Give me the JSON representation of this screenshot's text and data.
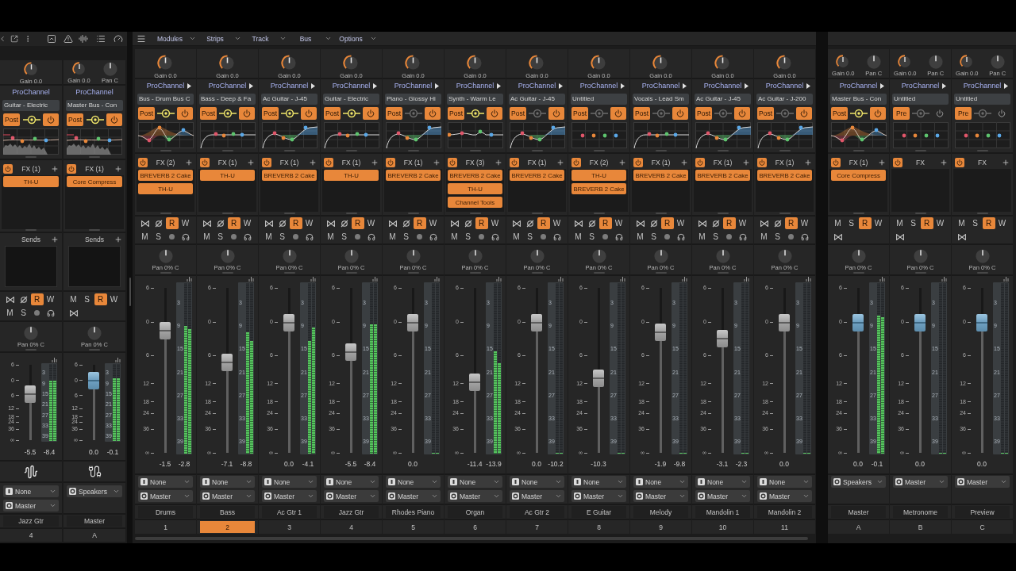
{
  "inspector": {
    "strips": [
      {
        "kind": "track",
        "knobs": [
          {
            "kind": "gain",
            "label": "Gain 0.0"
          }
        ],
        "prochannel": {
          "label": "ProChannel",
          "preset": "Guitar - Electric",
          "mode": "Post",
          "link": true,
          "power": true,
          "eq": {
            "kind": "analyzer"
          }
        },
        "fx": {
          "power": true,
          "label": "FX (1)",
          "plugins": [
            "TH-U"
          ]
        },
        "sends": {
          "label": "Sends"
        },
        "buttons": [
          [
            {
              "kind": "bypass",
              "on": false
            },
            {
              "kind": "phase",
              "on": false
            },
            {
              "kind": "text",
              "label": "R",
              "on": true
            },
            {
              "kind": "text",
              "label": "W",
              "on": false
            }
          ],
          [
            {
              "kind": "text",
              "label": "M",
              "on": false
            },
            {
              "kind": "text",
              "label": "S",
              "on": false
            },
            {
              "kind": "arm",
              "on": false
            },
            {
              "kind": "echo",
              "on": false
            }
          ]
        ],
        "pan": "Pan 0% C",
        "fader": {
          "scale": [
            "6",
            "0",
            "6",
            "12",
            "18",
            "24",
            "36",
            "∞"
          ],
          "meter_scale": [
            "3",
            "9",
            "15",
            "21",
            "27",
            "33",
            "39"
          ],
          "level": 0.61,
          "reading": "-5.5",
          "meters": [
            {
              "level": 0.78
            },
            {
              "level": 0.78
            }
          ],
          "peak": "-8.4"
        },
        "io": [
          {
            "kind": "input",
            "label": "None"
          },
          {
            "kind": "output",
            "label": "Master"
          }
        ],
        "name": "Jazz Gtr",
        "number": "4",
        "selected": false
      },
      {
        "kind": "bus",
        "knobs": [
          {
            "kind": "gain",
            "label": "Gain 0.0"
          },
          {
            "kind": "pan",
            "label": "Pan C"
          }
        ],
        "prochannel": {
          "label": "ProChannel",
          "preset": "Master Bus - Con",
          "mode": "Post",
          "link": true,
          "power": true,
          "eq": {
            "kind": "analyzer"
          }
        },
        "fx": {
          "power": true,
          "label": "FX (1)",
          "plugins": [
            "Core Compress"
          ]
        },
        "sends": {
          "label": "Sends"
        },
        "buttons": [
          [
            {
              "kind": "text",
              "label": "M",
              "on": false
            },
            {
              "kind": "text",
              "label": "S",
              "on": false
            },
            {
              "kind": "text",
              "label": "R",
              "on": true
            },
            {
              "kind": "text",
              "label": "W",
              "on": false
            }
          ],
          [
            {
              "kind": "bypass",
              "on": false
            }
          ]
        ],
        "pan": "Pan 0% C",
        "fader": {
          "scale": [
            "6",
            "0",
            "6",
            "12",
            "18",
            "24",
            "36",
            "∞"
          ],
          "meter_scale": [
            "3",
            "9",
            "15",
            "21",
            "27",
            "33",
            "39"
          ],
          "level": 0.79,
          "reading": "0.0",
          "meters": [
            {
              "level": 0.81
            },
            {
              "level": 0.81
            }
          ],
          "peak": "-0.1"
        },
        "io": [
          {
            "kind": "output",
            "label": "Speakers"
          }
        ],
        "name": "Master",
        "number": "A",
        "selected": false
      }
    ]
  },
  "console": {
    "menus": [
      {
        "label": "Modules"
      },
      {
        "label": "Strips"
      },
      {
        "label": "Track"
      },
      {
        "label": "Bus"
      },
      {
        "label": "Options"
      }
    ],
    "strips": [
      {
        "kind": "track",
        "knobs": [
          {
            "kind": "gain",
            "label": "Gain 0.0"
          }
        ],
        "prochannel": {
          "label": "ProChannel",
          "arrow": true,
          "preset": "Bus - Drum Bus C",
          "mode": "Post",
          "link": true,
          "power": true,
          "eq": {
            "kind": "peaks"
          }
        },
        "fx": {
          "power": true,
          "label": "FX (2)",
          "plugins": [
            "BREVERB 2 Cake",
            "TH-U"
          ]
        },
        "buttons": [
          [
            {
              "kind": "bypass",
              "on": false
            },
            {
              "kind": "phase",
              "on": false
            },
            {
              "kind": "text",
              "label": "R",
              "on": true
            },
            {
              "kind": "text",
              "label": "W",
              "on": false
            }
          ],
          [
            {
              "kind": "text",
              "label": "M",
              "on": false
            },
            {
              "kind": "text",
              "label": "S",
              "on": false
            },
            {
              "kind": "arm",
              "on": false
            },
            {
              "kind": "echo",
              "on": false
            }
          ]
        ],
        "pan": "Pan 0% C",
        "fader": {
          "scale": [
            "6",
            "0",
            "6",
            "12",
            "18",
            "24",
            "36",
            "∞"
          ],
          "meter_scale": [
            "3",
            "9",
            "15",
            "21",
            "27",
            "33",
            "39"
          ],
          "level": 0.74,
          "reading": "-1.5",
          "meters": [
            {
              "level": 0.75
            },
            {
              "level": 0.73
            }
          ],
          "peak": "-2.8"
        },
        "io": [
          {
            "kind": "input",
            "label": "None"
          },
          {
            "kind": "output",
            "label": "Master"
          }
        ],
        "name": "Drums",
        "number": "1",
        "selected": false
      },
      {
        "kind": "track",
        "knobs": [
          {
            "kind": "gain",
            "label": "Gain 0.0"
          }
        ],
        "prochannel": {
          "label": "ProChannel",
          "arrow": true,
          "preset": "Bass - Deep & Fa",
          "mode": "Post",
          "link": true,
          "power": true,
          "eq": {
            "kind": "lowcut"
          }
        },
        "fx": {
          "power": true,
          "label": "FX (1)",
          "plugins": [
            "TH-U"
          ]
        },
        "buttons": [
          [
            {
              "kind": "bypass",
              "on": false
            },
            {
              "kind": "phase",
              "on": false
            },
            {
              "kind": "text",
              "label": "R",
              "on": true
            },
            {
              "kind": "text",
              "label": "W",
              "on": false
            }
          ],
          [
            {
              "kind": "text",
              "label": "M",
              "on": false
            },
            {
              "kind": "text",
              "label": "S",
              "on": false
            },
            {
              "kind": "arm",
              "on": false
            },
            {
              "kind": "echo",
              "on": false
            }
          ]
        ],
        "pan": "Pan 0% C",
        "fader": {
          "scale": [
            "6",
            "0",
            "6",
            "12",
            "18",
            "24",
            "36",
            "∞"
          ],
          "meter_scale": [
            "3",
            "9",
            "15",
            "21",
            "27",
            "33",
            "39"
          ],
          "level": 0.55,
          "reading": "-7.1",
          "meters": [
            {
              "level": 0.71
            },
            {
              "level": 0.66
            }
          ],
          "peak": "-8.8"
        },
        "io": [
          {
            "kind": "input",
            "label": "None"
          },
          {
            "kind": "output",
            "label": "Master"
          }
        ],
        "name": "Bass",
        "number": "2",
        "selected": true
      },
      {
        "kind": "track",
        "knobs": [
          {
            "kind": "gain",
            "label": "Gain 0.0"
          }
        ],
        "prochannel": {
          "label": "ProChannel",
          "arrow": true,
          "preset": "Ac Guitar - J-45",
          "mode": "Post",
          "link": true,
          "power": true,
          "eq": {
            "kind": "shelf"
          }
        },
        "fx": {
          "power": true,
          "label": "FX (1)",
          "plugins": [
            "BREVERB 2 Cake"
          ]
        },
        "buttons": [
          [
            {
              "kind": "bypass",
              "on": false
            },
            {
              "kind": "phase",
              "on": false
            },
            {
              "kind": "text",
              "label": "R",
              "on": true
            },
            {
              "kind": "text",
              "label": "W",
              "on": false
            }
          ],
          [
            {
              "kind": "text",
              "label": "M",
              "on": false
            },
            {
              "kind": "text",
              "label": "S",
              "on": false
            },
            {
              "kind": "arm",
              "on": false
            },
            {
              "kind": "echo",
              "on": false
            }
          ]
        ],
        "pan": "Pan 0% C",
        "fader": {
          "scale": [
            "6",
            "0",
            "6",
            "12",
            "18",
            "24",
            "36",
            "∞"
          ],
          "meter_scale": [
            "3",
            "9",
            "15",
            "21",
            "27",
            "33",
            "39"
          ],
          "level": 0.79,
          "reading": "0.0",
          "meters": [
            {
              "level": 0.66
            },
            {
              "level": 0.74
            }
          ],
          "peak": "-4.1"
        },
        "io": [
          {
            "kind": "input",
            "label": "None"
          },
          {
            "kind": "output",
            "label": "Master"
          }
        ],
        "name": "Ac Gtr 1",
        "number": "3",
        "selected": false
      },
      {
        "kind": "track",
        "knobs": [
          {
            "kind": "gain",
            "label": "Gain 0.0"
          }
        ],
        "prochannel": {
          "label": "ProChannel",
          "arrow": true,
          "preset": "Guitar - Electric",
          "mode": "Post",
          "link": true,
          "power": true,
          "eq": {
            "kind": "lowcut"
          }
        },
        "fx": {
          "power": true,
          "label": "FX (1)",
          "plugins": [
            "TH-U"
          ]
        },
        "buttons": [
          [
            {
              "kind": "bypass",
              "on": false
            },
            {
              "kind": "phase",
              "on": false
            },
            {
              "kind": "text",
              "label": "R",
              "on": true
            },
            {
              "kind": "text",
              "label": "W",
              "on": false
            }
          ],
          [
            {
              "kind": "text",
              "label": "M",
              "on": false
            },
            {
              "kind": "text",
              "label": "S",
              "on": false
            },
            {
              "kind": "arm",
              "on": false
            },
            {
              "kind": "echo",
              "on": false
            }
          ]
        ],
        "pan": "Pan 0% C",
        "fader": {
          "scale": [
            "6",
            "0",
            "6",
            "12",
            "18",
            "24",
            "36",
            "∞"
          ],
          "meter_scale": [
            "3",
            "9",
            "15",
            "21",
            "27",
            "33",
            "39"
          ],
          "level": 0.61,
          "reading": "-5.5",
          "meters": [
            {
              "level": 0.76
            },
            {
              "level": 0.76
            }
          ],
          "peak": "-8.4"
        },
        "io": [
          {
            "kind": "input",
            "label": "None"
          },
          {
            "kind": "output",
            "label": "Master"
          }
        ],
        "name": "Jazz Gtr",
        "number": "4",
        "selected": false
      },
      {
        "kind": "track",
        "knobs": [
          {
            "kind": "gain",
            "label": "Gain 0.0"
          }
        ],
        "prochannel": {
          "label": "ProChannel",
          "arrow": true,
          "preset": "Piano - Glossy Hi",
          "mode": "Post",
          "link": false,
          "power": true,
          "eq": {
            "kind": "shelf"
          }
        },
        "fx": {
          "power": true,
          "label": "FX (1)",
          "plugins": [
            "BREVERB 2 Cake"
          ]
        },
        "buttons": [
          [
            {
              "kind": "bypass",
              "on": false
            },
            {
              "kind": "phase",
              "on": false
            },
            {
              "kind": "text",
              "label": "R",
              "on": true
            },
            {
              "kind": "text",
              "label": "W",
              "on": false
            }
          ],
          [
            {
              "kind": "text",
              "label": "M",
              "on": false
            },
            {
              "kind": "text",
              "label": "S",
              "on": false
            },
            {
              "kind": "arm",
              "on": false
            },
            {
              "kind": "echo",
              "on": false
            }
          ]
        ],
        "pan": "Pan 0% C",
        "fader": {
          "scale": [
            "6",
            "0",
            "6",
            "12",
            "18",
            "24",
            "36",
            "∞"
          ],
          "meter_scale": [
            "3",
            "9",
            "15",
            "21",
            "27",
            "33",
            "39"
          ],
          "level": 0.79,
          "reading": "0.0",
          "meters": [
            {
              "level": 0
            },
            {
              "level": 0
            }
          ]
        },
        "io": [
          {
            "kind": "input",
            "label": "None"
          },
          {
            "kind": "output",
            "label": "Master"
          }
        ],
        "name": "Rhodes Piano",
        "number": "5",
        "selected": false
      },
      {
        "kind": "track",
        "knobs": [
          {
            "kind": "gain",
            "label": "Gain 0.0"
          }
        ],
        "prochannel": {
          "label": "ProChannel",
          "arrow": true,
          "preset": "Synth - Warm Le",
          "mode": "Post",
          "link": true,
          "power": true,
          "eq": {
            "kind": "line"
          }
        },
        "fx": {
          "power": true,
          "label": "FX (3)",
          "plugins": [
            "BREVERB 2 Cake",
            "TH-U",
            "Channel Tools"
          ]
        },
        "buttons": [
          [
            {
              "kind": "bypass",
              "on": false
            },
            {
              "kind": "phase",
              "on": false
            },
            {
              "kind": "text",
              "label": "R",
              "on": true
            },
            {
              "kind": "text",
              "label": "W",
              "on": false
            }
          ],
          [
            {
              "kind": "text",
              "label": "M",
              "on": false
            },
            {
              "kind": "text",
              "label": "S",
              "on": false
            },
            {
              "kind": "arm",
              "on": false
            },
            {
              "kind": "echo",
              "on": false
            }
          ]
        ],
        "pan": "Pan 0% C",
        "fader": {
          "scale": [
            "6",
            "0",
            "6",
            "12",
            "18",
            "24",
            "36",
            "∞"
          ],
          "meter_scale": [
            "3",
            "9",
            "15",
            "21",
            "27",
            "33",
            "39"
          ],
          "level": 0.43,
          "reading": "-11.4",
          "meters": [
            {
              "level": 0.6
            },
            {
              "level": 0.53
            }
          ],
          "peak": "-13.9"
        },
        "io": [
          {
            "kind": "input",
            "label": "None"
          },
          {
            "kind": "output",
            "label": "Master"
          }
        ],
        "name": "Organ",
        "number": "6",
        "selected": false
      },
      {
        "kind": "track",
        "knobs": [
          {
            "kind": "gain",
            "label": "Gain 0.0"
          }
        ],
        "prochannel": {
          "label": "ProChannel",
          "arrow": true,
          "preset": "Ac Guitar - J-45",
          "mode": "Post",
          "link": false,
          "power": true,
          "eq": {
            "kind": "shelf"
          }
        },
        "fx": {
          "power": true,
          "label": "FX (1)",
          "plugins": [
            "BREVERB 2 Cake"
          ]
        },
        "buttons": [
          [
            {
              "kind": "bypass",
              "on": false
            },
            {
              "kind": "phase",
              "on": false
            },
            {
              "kind": "text",
              "label": "R",
              "on": true
            },
            {
              "kind": "text",
              "label": "W",
              "on": false
            }
          ],
          [
            {
              "kind": "text",
              "label": "M",
              "on": false
            },
            {
              "kind": "text",
              "label": "S",
              "on": false
            },
            {
              "kind": "arm",
              "on": false
            },
            {
              "kind": "echo",
              "on": false
            }
          ]
        ],
        "pan": "Pan 0% C",
        "fader": {
          "scale": [
            "6",
            "0",
            "6",
            "12",
            "18",
            "24",
            "36",
            "∞"
          ],
          "meter_scale": [
            "3",
            "9",
            "15",
            "21",
            "27",
            "33",
            "39"
          ],
          "level": 0.79,
          "reading": "0.0",
          "meters": [
            {
              "level": 0
            },
            {
              "level": 0
            }
          ],
          "peak": "-10.2"
        },
        "io": [
          {
            "kind": "input",
            "label": "None"
          },
          {
            "kind": "output",
            "label": "Master"
          }
        ],
        "name": "Ac Gtr 2",
        "number": "7",
        "selected": false
      },
      {
        "kind": "track",
        "knobs": [
          {
            "kind": "gain",
            "label": "Gain 0.0"
          }
        ],
        "prochannel": {
          "label": "ProChannel",
          "arrow": true,
          "preset": "Untitled",
          "mode": "Post",
          "link": false,
          "power": true,
          "eq": {
            "kind": "flat"
          }
        },
        "fx": {
          "power": true,
          "label": "FX (2)",
          "plugins": [
            "TH-U",
            "BREVERB 2 Cake"
          ]
        },
        "buttons": [
          [
            {
              "kind": "bypass",
              "on": false
            },
            {
              "kind": "phase",
              "on": false
            },
            {
              "kind": "text",
              "label": "R",
              "on": true
            },
            {
              "kind": "text",
              "label": "W",
              "on": false
            }
          ],
          [
            {
              "kind": "text",
              "label": "M",
              "on": false
            },
            {
              "kind": "text",
              "label": "S",
              "on": false
            },
            {
              "kind": "arm",
              "on": false
            },
            {
              "kind": "echo",
              "on": false
            }
          ]
        ],
        "pan": "Pan 0% C",
        "fader": {
          "scale": [
            "6",
            "0",
            "6",
            "12",
            "18",
            "24",
            "36",
            "∞"
          ],
          "meter_scale": [
            "3",
            "9",
            "15",
            "21",
            "27",
            "33",
            "39"
          ],
          "level": 0.45,
          "reading": "-10.3",
          "meters": [
            {
              "level": 0
            },
            {
              "level": 0
            }
          ]
        },
        "io": [
          {
            "kind": "input",
            "label": "None"
          },
          {
            "kind": "output",
            "label": "Master"
          }
        ],
        "name": "E Guitar",
        "number": "8",
        "selected": false
      },
      {
        "kind": "track",
        "knobs": [
          {
            "kind": "gain",
            "label": "Gain 0.0"
          }
        ],
        "prochannel": {
          "label": "ProChannel",
          "arrow": true,
          "preset": "Vocals - Lead Sm",
          "mode": "Post",
          "link": false,
          "power": true,
          "eq": {
            "kind": "lowcut"
          }
        },
        "fx": {
          "power": true,
          "label": "FX (1)",
          "plugins": [
            "BREVERB 2 Cake"
          ]
        },
        "buttons": [
          [
            {
              "kind": "bypass",
              "on": false
            },
            {
              "kind": "phase",
              "on": false
            },
            {
              "kind": "text",
              "label": "R",
              "on": true
            },
            {
              "kind": "text",
              "label": "W",
              "on": false
            }
          ],
          [
            {
              "kind": "text",
              "label": "M",
              "on": false
            },
            {
              "kind": "text",
              "label": "S",
              "on": false
            },
            {
              "kind": "arm",
              "on": false
            },
            {
              "kind": "echo",
              "on": false
            }
          ]
        ],
        "pan": "Pan 0% C",
        "fader": {
          "scale": [
            "6",
            "0",
            "6",
            "12",
            "18",
            "24",
            "36",
            "∞"
          ],
          "meter_scale": [
            "3",
            "9",
            "15",
            "21",
            "27",
            "33",
            "39"
          ],
          "level": 0.73,
          "reading": "-1.9",
          "meters": [
            {
              "level": 0
            },
            {
              "level": 0
            }
          ],
          "peak": "-9.8"
        },
        "io": [
          {
            "kind": "input",
            "label": "None"
          },
          {
            "kind": "output",
            "label": "Master"
          }
        ],
        "name": "Melody",
        "number": "9",
        "selected": false
      },
      {
        "kind": "track",
        "knobs": [
          {
            "kind": "gain",
            "label": "Gain 0.0"
          }
        ],
        "prochannel": {
          "label": "ProChannel",
          "arrow": true,
          "preset": "Ac Guitar - J-45",
          "mode": "Post",
          "link": false,
          "power": true,
          "eq": {
            "kind": "shelf"
          }
        },
        "fx": {
          "power": true,
          "label": "FX (1)",
          "plugins": [
            "BREVERB 2 Cake"
          ]
        },
        "buttons": [
          [
            {
              "kind": "bypass",
              "on": false
            },
            {
              "kind": "phase",
              "on": false
            },
            {
              "kind": "text",
              "label": "R",
              "on": true
            },
            {
              "kind": "text",
              "label": "W",
              "on": false
            }
          ],
          [
            {
              "kind": "text",
              "label": "M",
              "on": false
            },
            {
              "kind": "text",
              "label": "S",
              "on": false
            },
            {
              "kind": "arm",
              "on": false
            },
            {
              "kind": "echo",
              "on": false
            }
          ]
        ],
        "pan": "Pan 0% C",
        "fader": {
          "scale": [
            "6",
            "0",
            "6",
            "12",
            "18",
            "24",
            "36",
            "∞"
          ],
          "meter_scale": [
            "3",
            "9",
            "15",
            "21",
            "27",
            "33",
            "39"
          ],
          "level": 0.69,
          "reading": "-3.1",
          "meters": [
            {
              "level": 0
            },
            {
              "level": 0
            }
          ],
          "peak": "-2.3"
        },
        "io": [
          {
            "kind": "input",
            "label": "None"
          },
          {
            "kind": "output",
            "label": "Master"
          }
        ],
        "name": "Mandolin 1",
        "number": "10",
        "selected": false
      },
      {
        "kind": "track",
        "knobs": [
          {
            "kind": "gain",
            "label": "Gain 0.0"
          }
        ],
        "prochannel": {
          "label": "ProChannel",
          "arrow": true,
          "preset": "Ac Guitar - J-200",
          "mode": "Post",
          "link": false,
          "power": true,
          "eq": {
            "kind": "shelf"
          }
        },
        "fx": {
          "power": true,
          "label": "FX (1)",
          "plugins": [
            "BREVERB 2 Cake"
          ]
        },
        "buttons": [
          [
            {
              "kind": "bypass",
              "on": false
            },
            {
              "kind": "phase",
              "on": false
            },
            {
              "kind": "text",
              "label": "R",
              "on": true
            },
            {
              "kind": "text",
              "label": "W",
              "on": false
            }
          ],
          [
            {
              "kind": "text",
              "label": "M",
              "on": false
            },
            {
              "kind": "text",
              "label": "S",
              "on": false
            },
            {
              "kind": "arm",
              "on": false
            },
            {
              "kind": "echo",
              "on": false
            }
          ]
        ],
        "pan": "Pan 0% C",
        "fader": {
          "scale": [
            "6",
            "0",
            "6",
            "12",
            "18",
            "24",
            "36",
            "∞"
          ],
          "meter_scale": [
            "3",
            "9",
            "15",
            "21",
            "27",
            "33",
            "39"
          ],
          "level": 0.79,
          "reading": "0.0",
          "meters": [
            {
              "level": 0
            },
            {
              "level": 0
            }
          ]
        },
        "io": [
          {
            "kind": "input",
            "label": "None"
          },
          {
            "kind": "output",
            "label": "Master"
          }
        ],
        "name": "Mandolin 2",
        "number": "11",
        "selected": false
      }
    ]
  },
  "buses": {
    "strips": [
      {
        "kind": "bus",
        "knobs": [
          {
            "kind": "gain",
            "label": "Gain 0.0"
          },
          {
            "kind": "pan",
            "label": "Pan C"
          }
        ],
        "prochannel": {
          "label": "ProChannel",
          "arrow": true,
          "preset": "Master Bus - Con",
          "mode": "Post",
          "link": true,
          "power": true,
          "eq": {
            "kind": "peaks"
          }
        },
        "fx": {
          "power": true,
          "label": "FX (1)",
          "plugins": [
            "Core Compress"
          ]
        },
        "buttons": [
          [
            {
              "kind": "text",
              "label": "M",
              "on": false
            },
            {
              "kind": "text",
              "label": "S",
              "on": false
            },
            {
              "kind": "text",
              "label": "R",
              "on": true
            },
            {
              "kind": "text",
              "label": "W",
              "on": false
            }
          ],
          [
            {
              "kind": "bypass",
              "on": false
            }
          ]
        ],
        "pan": "Pan 0% C",
        "fader": {
          "scale": [
            "6",
            "0",
            "6",
            "12",
            "18",
            "24",
            "36",
            "∞"
          ],
          "meter_scale": [
            "3",
            "9",
            "15",
            "21",
            "27",
            "33",
            "39"
          ],
          "level": 0.79,
          "reading": "0.0",
          "meters": [
            {
              "level": 0.81
            },
            {
              "level": 0.8
            }
          ],
          "peak": "-0.1"
        },
        "io": [
          {
            "kind": "output",
            "label": "Speakers"
          }
        ],
        "name": "Master",
        "number": "A",
        "selected": false
      },
      {
        "kind": "bus",
        "knobs": [
          {
            "kind": "gain",
            "label": "Gain 0.0"
          },
          {
            "kind": "pan",
            "label": "Pan C"
          }
        ],
        "prochannel": {
          "label": "ProChannel",
          "arrow": true,
          "preset": "Untitled",
          "mode": "Pre",
          "link": false,
          "power": false,
          "eq": {
            "kind": "flat"
          }
        },
        "fx": {
          "power": true,
          "label": "FX"
        },
        "buttons": [
          [
            {
              "kind": "text",
              "label": "M",
              "on": false
            },
            {
              "kind": "text",
              "label": "S",
              "on": false
            },
            {
              "kind": "text",
              "label": "R",
              "on": true
            },
            {
              "kind": "text",
              "label": "W",
              "on": false
            }
          ],
          [
            {
              "kind": "bypass",
              "on": false
            }
          ]
        ],
        "pan": "Pan 0% C",
        "fader": {
          "scale": [
            "6",
            "0",
            "6",
            "12",
            "18",
            "24",
            "36",
            "∞"
          ],
          "meter_scale": [
            "3",
            "9",
            "15",
            "21",
            "27",
            "33",
            "39"
          ],
          "level": 0.79,
          "reading": "0.0",
          "meters": [
            {
              "level": 0
            },
            {
              "level": 0
            }
          ]
        },
        "io": [
          {
            "kind": "output",
            "label": "Master"
          }
        ],
        "name": "Metronome",
        "number": "B",
        "selected": false
      },
      {
        "kind": "bus",
        "knobs": [
          {
            "kind": "gain",
            "label": "Gain 0.0"
          },
          {
            "kind": "pan",
            "label": "Pan C"
          }
        ],
        "prochannel": {
          "label": "ProChannel",
          "arrow": true,
          "preset": "Untitled",
          "mode": "Pre",
          "link": false,
          "power": false,
          "eq": {
            "kind": "flat"
          }
        },
        "fx": {
          "power": true,
          "label": "FX"
        },
        "buttons": [
          [
            {
              "kind": "text",
              "label": "M",
              "on": false
            },
            {
              "kind": "text",
              "label": "S",
              "on": false
            },
            {
              "kind": "text",
              "label": "R",
              "on": true
            },
            {
              "kind": "text",
              "label": "W",
              "on": false
            }
          ],
          [
            {
              "kind": "bypass",
              "on": false
            }
          ]
        ],
        "pan": "Pan 0% C",
        "fader": {
          "scale": [
            "6",
            "0",
            "6",
            "12",
            "18",
            "24",
            "36",
            "∞"
          ],
          "meter_scale": [
            "3",
            "9",
            "15",
            "21",
            "27",
            "33",
            "39"
          ],
          "level": 0.79,
          "reading": "0.0",
          "meters": [
            {
              "level": 0
            },
            {
              "level": 0
            }
          ]
        },
        "io": [
          {
            "kind": "output",
            "label": "Master"
          }
        ],
        "name": "Preview",
        "number": "C",
        "selected": false
      }
    ]
  }
}
